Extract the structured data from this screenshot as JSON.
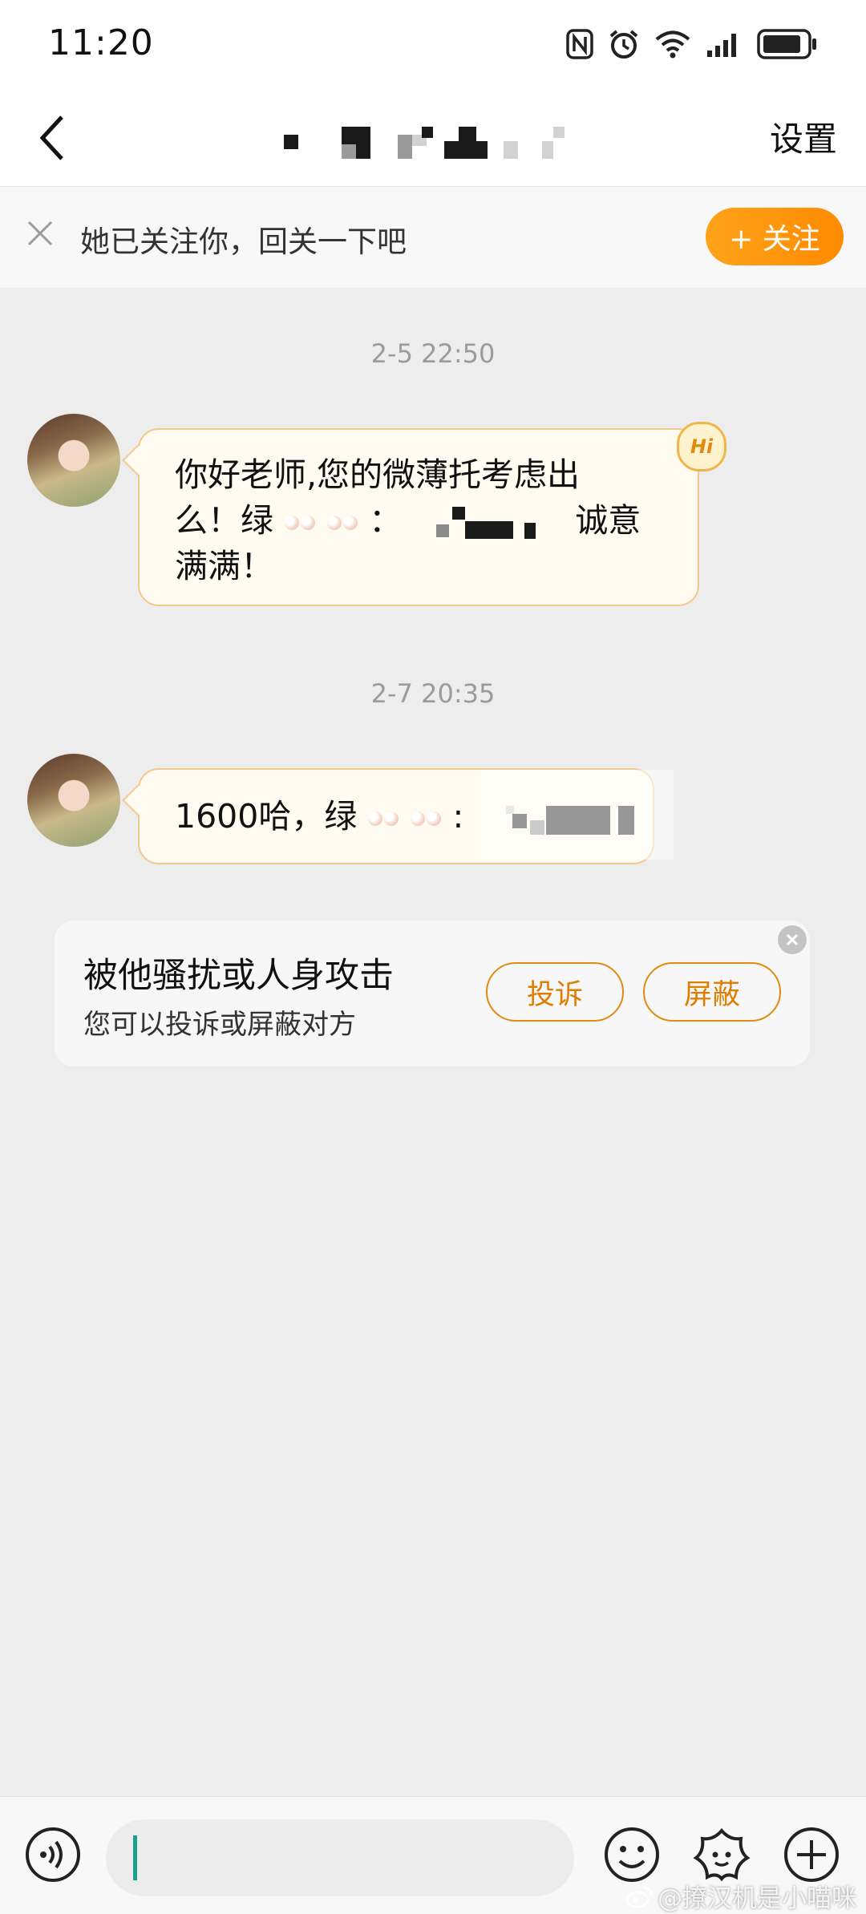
{
  "status_bar": {
    "time": "11:20"
  },
  "header": {
    "settings_label": "设置"
  },
  "follow_banner": {
    "text": "她已关注你，回关一下吧",
    "follow_button": "+ 关注"
  },
  "messages": [
    {
      "timestamp": "2-5 22:50",
      "text_line1": "你好老师,您的微薄托考虑出",
      "text_line2_a": "么！绿",
      "text_line2_b": "：",
      "text_line2_c": "诚意",
      "text_line3": "满满！",
      "badge": "Hi"
    },
    {
      "timestamp": "2-7 20:35",
      "text_a": "1600哈，绿",
      "text_b": ":"
    }
  ],
  "report_card": {
    "title": "被他骚扰或人身攻击",
    "subtitle": "您可以投诉或屏蔽对方",
    "complain_button": "投诉",
    "block_button": "屏蔽"
  },
  "input_bar": {
    "placeholder": ""
  },
  "watermark": "@撩汉机是小喵咪",
  "colors": {
    "accent": "#ff9500",
    "bubble_border": "#f2c98c",
    "bubble_bg": "#fffbf0"
  }
}
